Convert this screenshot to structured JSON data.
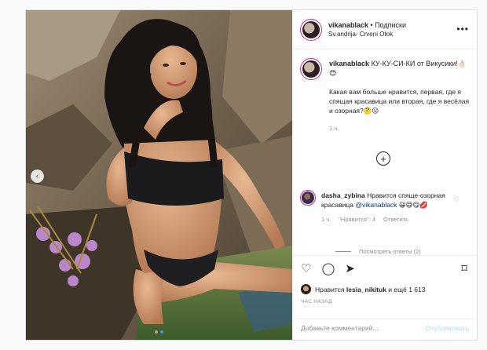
{
  "post": {
    "username": "vikanablack",
    "follow_label": "• Подписки",
    "location": "Sv.andrija- Crveni Otok",
    "caption_title": "КУ-КУ-СИ-КИ от Викусики!👌🏻😍",
    "caption_text": "Какая вам больше нравится, первая, где я спящая красавица или вторая, где я весёлая и озорная?🤔😛",
    "caption_time": "1 ч.",
    "more_icon": "•••"
  },
  "comment": {
    "username": "dasha_zybina",
    "text": "Нравится спяще-озорная красавица",
    "mention": "@vikanablack",
    "emoji": "😀😅😋💋",
    "time": "1 ч.",
    "likes": "\"Нравится\": 4",
    "reply": "Ответить",
    "view_replies": "Посмотреть ответы (2)"
  },
  "actions": {
    "likes_prefix": "Нравится",
    "liker": "lesia_nikituk",
    "likes_suffix": "и ещё 1 613",
    "time_ago": "ЧАС НАЗАД",
    "comment_placeholder": "Добавьте комментарий...",
    "publish": "Опубликовать"
  },
  "icons": {
    "heart": "♡",
    "comment": "◯",
    "share": "➤",
    "bookmark": "⌑",
    "plus": "+",
    "prev": "‹"
  },
  "colors": {
    "accent": "#3897f0",
    "mention": "#00376b",
    "muted": "#8e8e8e"
  }
}
